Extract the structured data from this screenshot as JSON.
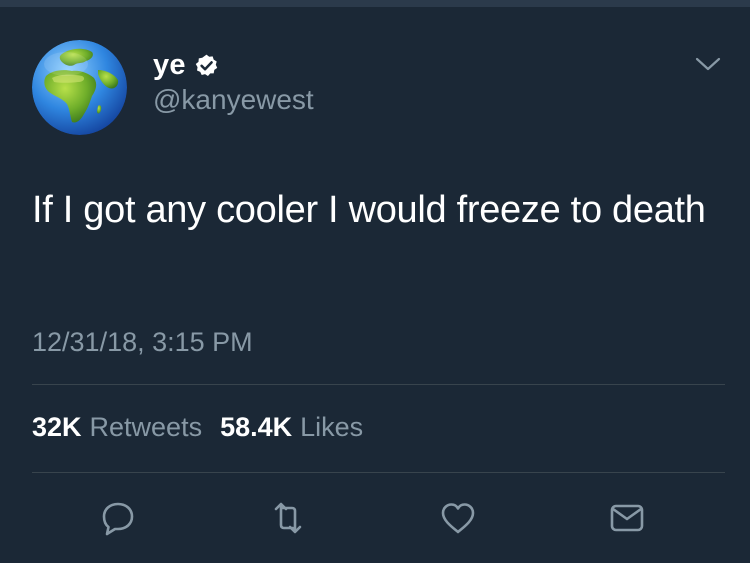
{
  "tweet": {
    "display_name": "ye",
    "handle": "@kanyewest",
    "verified": true,
    "avatar_icon": "globe-africa-europe-icon",
    "text": "If I got any cooler I would freeze to death",
    "timestamp": "12/31/18, 3:15 PM",
    "retweets": {
      "count": "32K",
      "label": "Retweets"
    },
    "likes": {
      "count": "58.4K",
      "label": "Likes"
    }
  },
  "actions": {
    "reply_icon": "reply-icon",
    "retweet_icon": "retweet-icon",
    "like_icon": "heart-icon",
    "dm_icon": "mail-icon",
    "menu_icon": "chevron-down-icon"
  },
  "colors": {
    "background": "#1b2836",
    "secondary_text": "#8899a6",
    "divider": "#38444d",
    "verified_badge": "#ffffff"
  }
}
